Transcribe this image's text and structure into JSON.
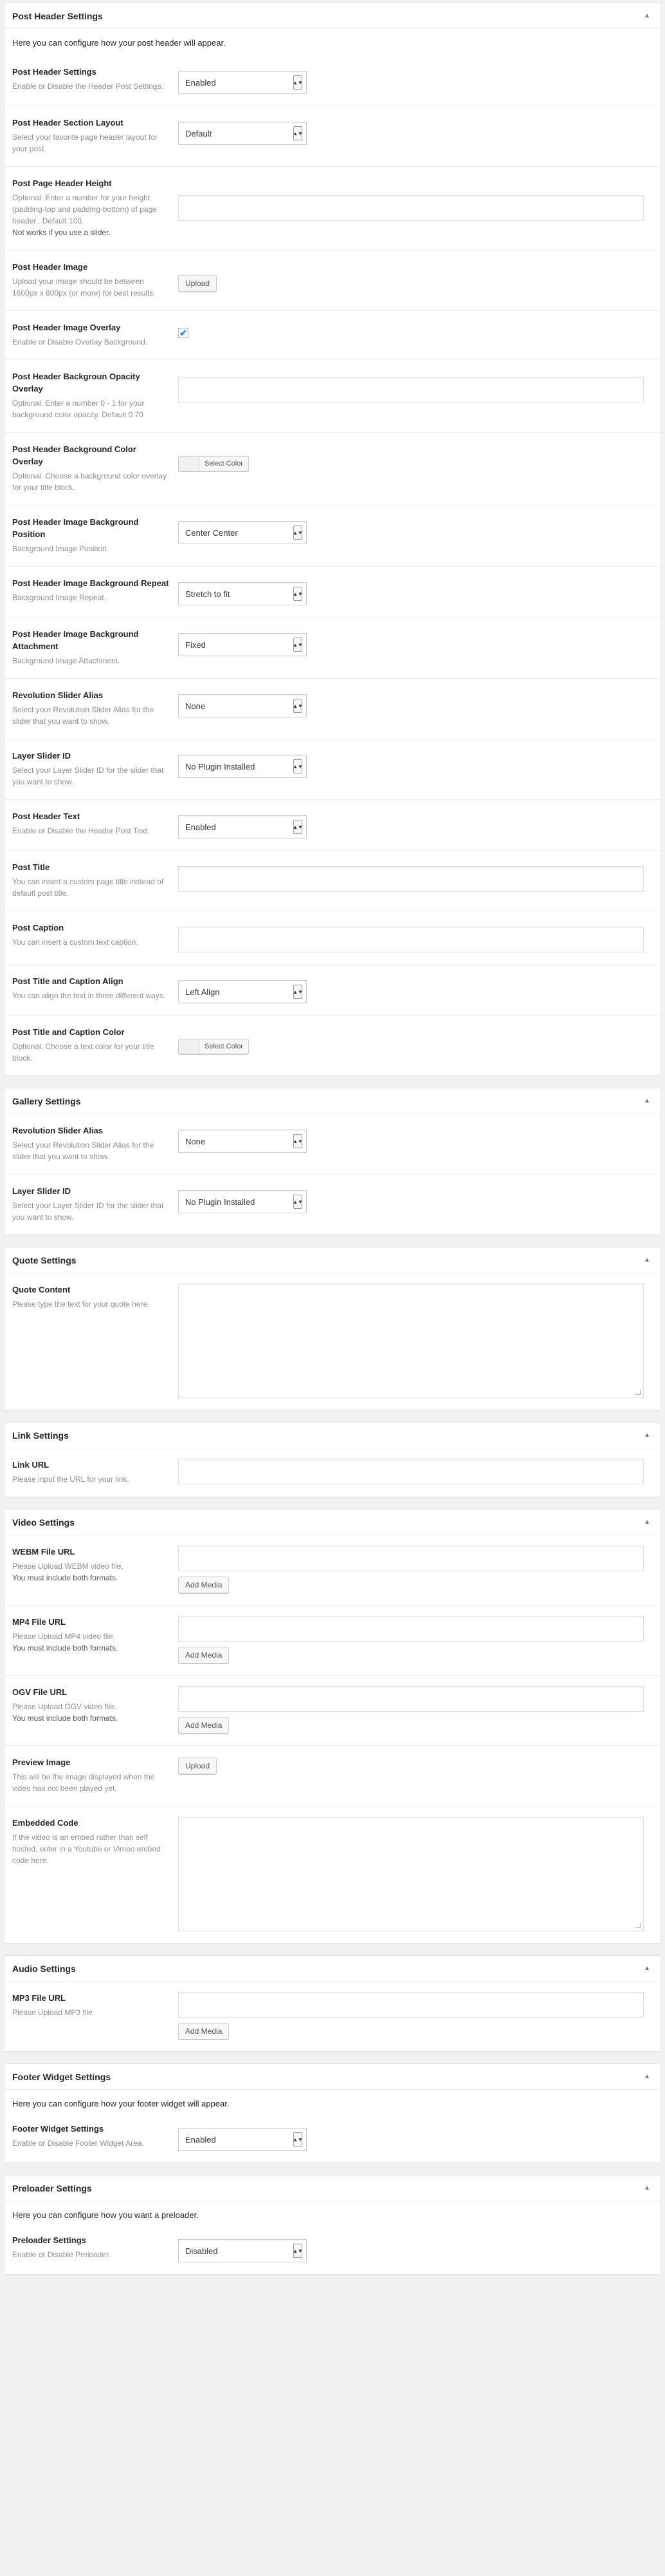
{
  "header_settings": {
    "title": "Post Header Settings",
    "intro": "Here you can configure how your post header will appear.",
    "fields": {
      "header_settings": {
        "label": "Post Header Settings",
        "desc": "Enable or Disable the Header Post Settings.",
        "value": "Enabled"
      },
      "section_layout": {
        "label": "Post Header Section Layout",
        "desc": "Select your favorite page header layout for your post.",
        "value": "Default"
      },
      "page_header_height": {
        "label": "Post Page Header Height",
        "desc": "Optional. Enter a number for your height (padding-top and padding-bottom) of page header.. Default 100.",
        "note": "Not works if you use a slider.",
        "value": ""
      },
      "header_image": {
        "label": "Post Header Image",
        "desc": "Upload your image should be between 1600px x 800px (or more) for best results.",
        "button": "Upload"
      },
      "image_overlay": {
        "label": "Post Header Image Overlay",
        "desc": "Enable or Disable Overlay Background.",
        "checked": "✔"
      },
      "bg_opacity": {
        "label": "Post Header Backgroun Opacity Overlay",
        "desc": "Optional. Enter a number 0 - 1 for your background color opacity. Default 0.70",
        "value": ""
      },
      "bg_color": {
        "label": "Post Header Background Color Overlay",
        "desc": "Optional. Choose a background color overlay for your title block.",
        "button": "Select Color"
      },
      "bg_position": {
        "label": "Post Header Image Background Position",
        "desc": "Background Image Position.",
        "value": "Center Center"
      },
      "bg_repeat": {
        "label": "Post Header Image Background Repeat",
        "desc": "Background Image Repeat.",
        "value": "Stretch to fit"
      },
      "bg_attachment": {
        "label": "Post Header Image Background Attachment",
        "desc": "Background Image Attachment.",
        "value": "Fixed"
      },
      "rev_slider": {
        "label": "Revolution Slider Alias",
        "desc": "Select your Revolution Slider Alias for the slider that you want to show.",
        "value": "None"
      },
      "layer_slider": {
        "label": "Layer Slider ID",
        "desc": "Select your Layer Slider ID for the slider that you want to show.",
        "value": "No Plugin Installed"
      },
      "header_text": {
        "label": "Post Header Text",
        "desc": "Enable or Disable the Header Post Text.",
        "value": "Enabled"
      },
      "post_title": {
        "label": "Post Title",
        "desc": "You can insert a custom page title instead of default post title.",
        "value": ""
      },
      "post_caption": {
        "label": "Post Caption",
        "desc": "You can insert a custom text caption.",
        "value": ""
      },
      "caption_align": {
        "label": "Post Title and Caption Align",
        "desc": "You can align the text in three different ways.",
        "value": "Left Align"
      },
      "caption_color": {
        "label": "Post Title and Caption Color",
        "desc": "Optional. Choose a text color for your title block.",
        "button": "Select Color"
      }
    }
  },
  "gallery_settings": {
    "title": "Gallery Settings",
    "fields": {
      "rev_slider": {
        "label": "Revolution Slider Alias",
        "desc": "Select your Revolution Slider Alias for the slider that you want to show.",
        "value": "None"
      },
      "layer_slider": {
        "label": "Layer Slider ID",
        "desc": "Select your Layer Slider ID for the slider that you want to show.",
        "value": "No Plugin Installed"
      }
    }
  },
  "quote_settings": {
    "title": "Quote Settings",
    "fields": {
      "quote_content": {
        "label": "Quote Content",
        "desc": "Please type the text for your quote here.",
        "value": ""
      }
    }
  },
  "link_settings": {
    "title": "Link Settings",
    "fields": {
      "link_url": {
        "label": "Link URL",
        "desc": "Please input the URL for your link.",
        "value": ""
      }
    }
  },
  "video_settings": {
    "title": "Video Settings",
    "fields": {
      "webm": {
        "label": "WEBM File URL",
        "desc": "Please Upload WEBM video file.",
        "note": "You must include both formats.",
        "button": "Add Media"
      },
      "mp4": {
        "label": "MP4 File URL",
        "desc": "Please Upload MP4 video file.",
        "note": "You must include both formats.",
        "button": "Add Media"
      },
      "ogv": {
        "label": "OGV File URL",
        "desc": "Please Upload OGV video file.",
        "note": "You must include both formats.",
        "button": "Add Media"
      },
      "preview": {
        "label": "Preview Image",
        "desc": "This will be the image displayed when the video has not been played yet.",
        "button": "Upload"
      },
      "embedded": {
        "label": "Embedded Code",
        "desc": "If the video is an embed rather than self hosted, enter in a Youtube or Vimeo embed code here.",
        "value": ""
      }
    }
  },
  "audio_settings": {
    "title": "Audio Settings",
    "fields": {
      "mp3": {
        "label": "MP3 File URL",
        "desc": "Please Upload MP3 file",
        "button": "Add Media"
      }
    }
  },
  "footer_widget_settings": {
    "title": "Footer Widget Settings",
    "intro": "Here you can configure how your footer widget will appear.",
    "fields": {
      "footer_widget": {
        "label": "Footer Widget Settings",
        "desc": "Enable or Disable Footer Widget Area.",
        "value": "Enabled"
      }
    }
  },
  "preloader_settings": {
    "title": "Preloader Settings",
    "intro": "Here you can configure how you want a preloader.",
    "fields": {
      "preloader": {
        "label": "Preloader Settings",
        "desc": "Enable or Disable Preloader.",
        "value": "Disabled"
      }
    }
  },
  "icons": {
    "toggle": "collapse-arrow-icon",
    "caret": "select-caret-icon",
    "check": "checkmark-icon"
  },
  "colors": {
    "background": "#f1f1f1",
    "panel": "#ffffff",
    "checkmark": "#1e8cbe",
    "desc_text": "#8a8f94"
  }
}
